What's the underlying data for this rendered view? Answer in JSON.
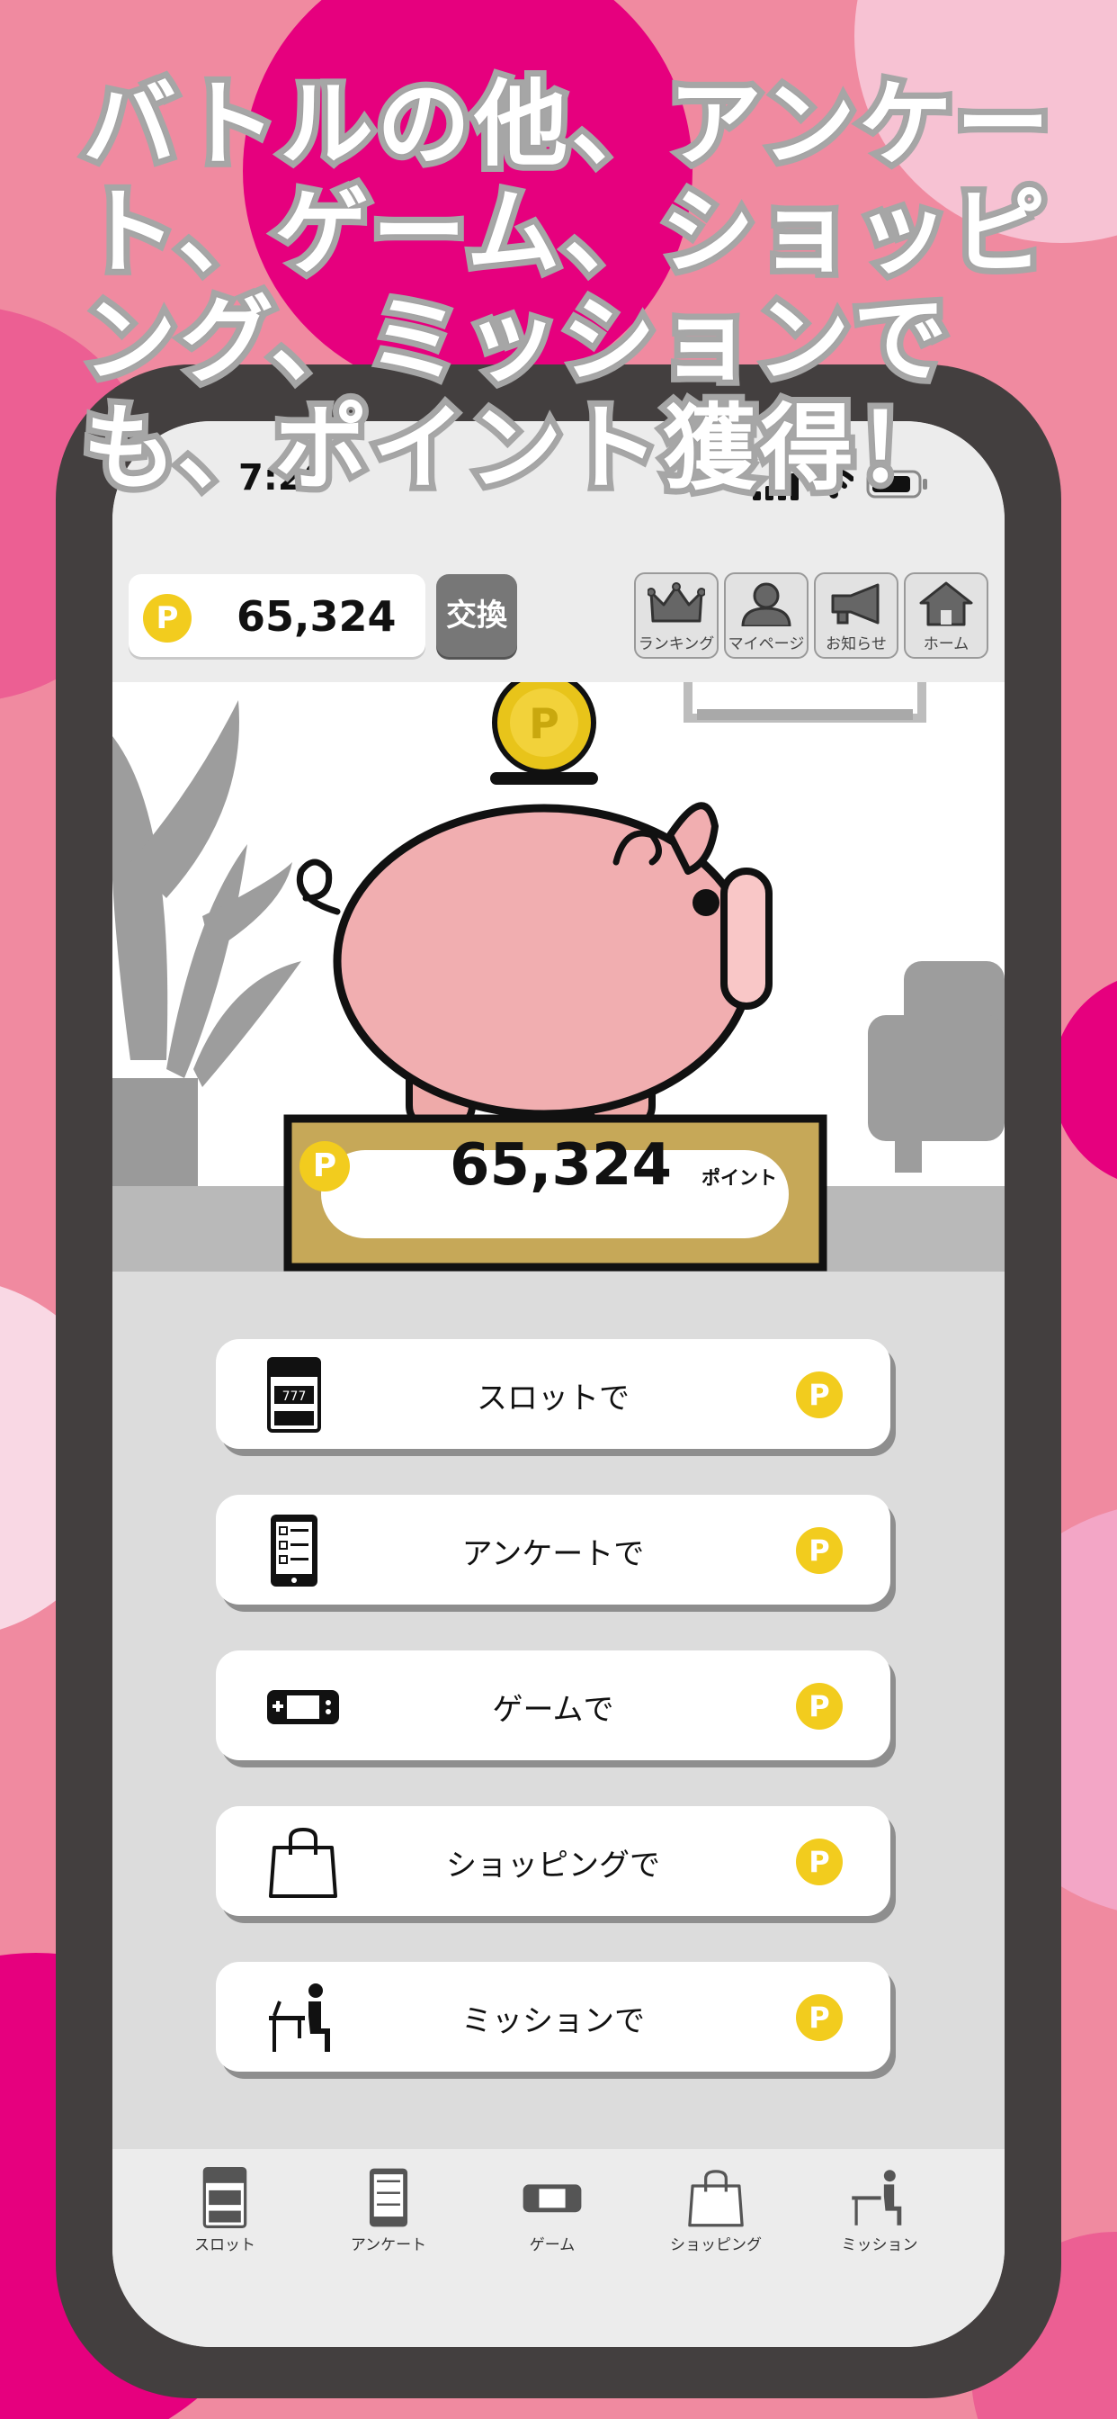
{
  "headline": "バトルの他、アンケート、ゲーム、ショッピング、ミッションでも、ポイント獲得！",
  "colors": {
    "accent_pink": "#e6007e",
    "coin_yellow": "#f2cc1e",
    "phone_frame": "#433f3f",
    "pig": "#f1aeb0",
    "plaque_gold": "#c6a858"
  },
  "status_bar": {
    "time": "7:26"
  },
  "header": {
    "coin_symbol": "P",
    "points": "65,324",
    "exchange_label": "交換",
    "nav": [
      {
        "label": "ランキング",
        "icon": "crown-icon"
      },
      {
        "label": "マイページ",
        "icon": "person-icon"
      },
      {
        "label": "お知らせ",
        "icon": "megaphone-icon"
      },
      {
        "label": "ホーム",
        "icon": "home-icon"
      }
    ]
  },
  "hero": {
    "coin_symbol": "P",
    "points": "65,324",
    "unit": "ポイント"
  },
  "menu": [
    {
      "label": "スロットで",
      "icon": "slot-machine-icon",
      "coin": "P"
    },
    {
      "label": "アンケートで",
      "icon": "survey-tablet-icon",
      "coin": "P"
    },
    {
      "label": "ゲームで",
      "icon": "game-console-icon",
      "coin": "P"
    },
    {
      "label": "ショッピングで",
      "icon": "shopping-bag-icon",
      "coin": "P"
    },
    {
      "label": "ミッションで",
      "icon": "mission-desk-icon",
      "coin": "P"
    }
  ],
  "tabs": [
    {
      "label": "スロット",
      "icon": "slot-machine-icon"
    },
    {
      "label": "アンケート",
      "icon": "survey-tablet-icon"
    },
    {
      "label": "ゲーム",
      "icon": "game-console-icon"
    },
    {
      "label": "ショッピング",
      "icon": "shopping-bag-icon"
    },
    {
      "label": "ミッション",
      "icon": "mission-desk-icon"
    }
  ]
}
